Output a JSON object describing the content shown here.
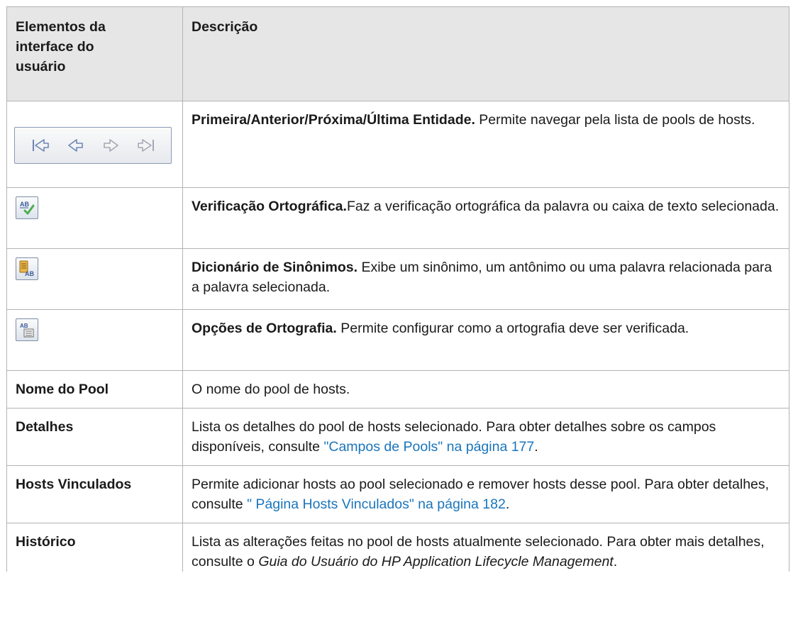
{
  "header": {
    "col1": "Elementos da interface do usuário",
    "col2": "Descrição"
  },
  "icons": {
    "nav": [
      "first-entity-icon",
      "previous-entity-icon",
      "next-entity-icon",
      "last-entity-icon"
    ],
    "spell_check": "spell-check-icon",
    "thesaurus": "thesaurus-icon",
    "spelling_options": "spelling-options-icon"
  },
  "rows": {
    "nav": {
      "title": "Primeira/Anterior/Próxima/Última Entidade.",
      "text": " Permite navegar pela lista de pools de hosts."
    },
    "spell": {
      "title": "Verificação Ortográfica.",
      "text": "Faz a verificação ortográfica da palavra ou caixa de texto selecionada."
    },
    "thesaurus": {
      "title": "Dicionário de Sinônimos.",
      "text": " Exibe um sinônimo, um antônimo ou uma palavra relacionada para a palavra selecionada."
    },
    "options": {
      "title": "Opções de Ortografia.",
      "text": " Permite configurar como a ortografia deve ser verificada."
    },
    "pool_name": {
      "name": "Nome do Pool",
      "text": "O nome do pool de hosts."
    },
    "details": {
      "name": "Detalhes",
      "text": "Lista os detalhes do pool de hosts selecionado. Para obter detalhes sobre os campos disponíveis, consulte ",
      "link": "\"Campos de Pools\" na página 177",
      "after": "."
    },
    "linked_hosts": {
      "name": "Hosts Vinculados",
      "text": "Permite adicionar hosts ao pool selecionado e remover hosts desse pool. Para obter detalhes, consulte ",
      "link": "\" Página Hosts Vinculados\" na página 182",
      "after": "."
    },
    "history": {
      "name": "Histórico",
      "text": "Lista as alterações feitas no pool de hosts atualmente selecionado. Para obter mais detalhes, consulte o ",
      "italic": "Guia do Usuário do HP Application Lifecycle Management",
      "after": "."
    }
  },
  "colors": {
    "link": "#1a75bb",
    "header_bg": "#e6e6e6",
    "border": "#b3b3b3"
  }
}
